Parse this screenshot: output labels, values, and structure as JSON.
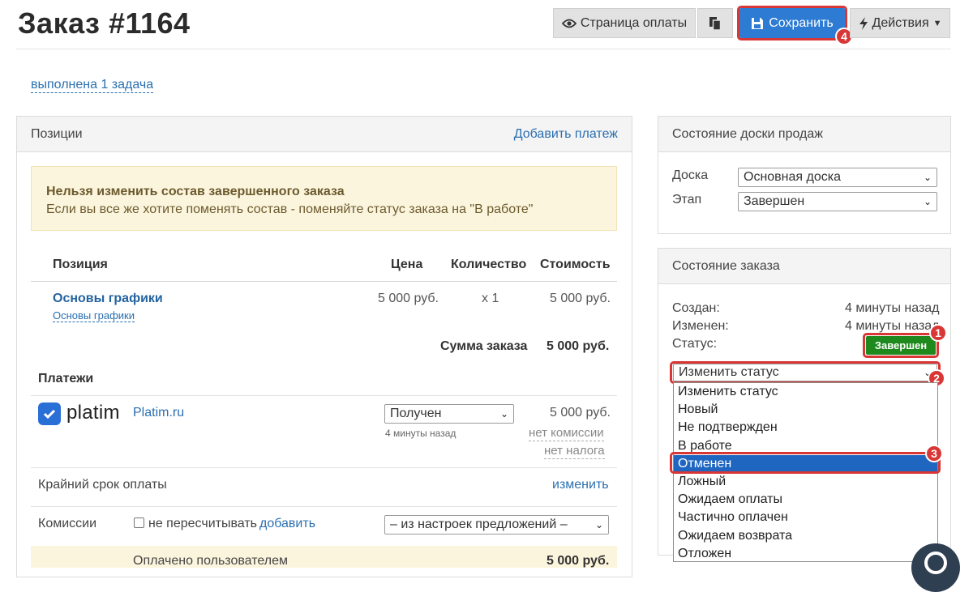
{
  "header": {
    "title": "Заказ #1164",
    "payment_page_label": "Страница оплаты",
    "save_label": "Сохранить",
    "actions_label": "Действия"
  },
  "tasks_link": "выполнена 1 задача",
  "positions_panel": {
    "title": "Позиции",
    "add_payment_label": "Добавить платеж",
    "warning_title": "Нельзя изменить состав завершенного заказа",
    "warning_text": "Если вы все же хотите поменять состав - поменяйте статус заказа на \"В работе\"",
    "columns": {
      "position": "Позиция",
      "price": "Цена",
      "quantity": "Количество",
      "cost": "Стоимость"
    },
    "item": {
      "name": "Основы графики",
      "sub": "Основы графики",
      "price": "5 000 руб.",
      "quantity": "x 1",
      "cost": "5 000 руб."
    },
    "total_label": "Сумма заказа",
    "total_value": "5 000 руб.",
    "payments_title": "Платежи",
    "payment": {
      "logo_text": "platim",
      "provider": "Platim.ru",
      "status": "Получен",
      "time": "4 минуты назад",
      "amount": "5 000 руб.",
      "no_commission": "нет комиссии",
      "no_tax": "нет налога"
    },
    "deadline_label": "Крайний срок оплаты",
    "deadline_change": "изменить",
    "commissions_label": "Комиссии",
    "no_recalc_label": "не пересчитывать",
    "add_label": "добавить",
    "commission_select": "– из настроек предложений –",
    "paid_label": "Оплачено пользователем",
    "paid_value": "5 000 руб."
  },
  "sales_board": {
    "title": "Состояние доски продаж",
    "board_label": "Доска",
    "board_value": "Основная доска",
    "stage_label": "Этап",
    "stage_value": "Завершен"
  },
  "order_state": {
    "title": "Состояние заказа",
    "created_label": "Создан:",
    "created_value": "4 минуты назад",
    "changed_label": "Изменен:",
    "changed_value": "4 минуты назад",
    "status_label": "Статус:",
    "status_badge": "Завершен",
    "change_status_value": "Изменить статус",
    "options": [
      "Изменить статус",
      "Новый",
      "Не подтвержден",
      "В работе",
      "Отменен",
      "Ложный",
      "Ожидаем оплаты",
      "Частично оплачен",
      "Ожидаем возврата",
      "Отложен"
    ],
    "highlighted_option": "Отменен"
  },
  "annotations": [
    "1",
    "2",
    "3",
    "4"
  ],
  "colors": {
    "accent": "#2d7bd3",
    "highlight": "#d93636",
    "success": "#1e8a1e",
    "selected": "#1f66c1"
  }
}
